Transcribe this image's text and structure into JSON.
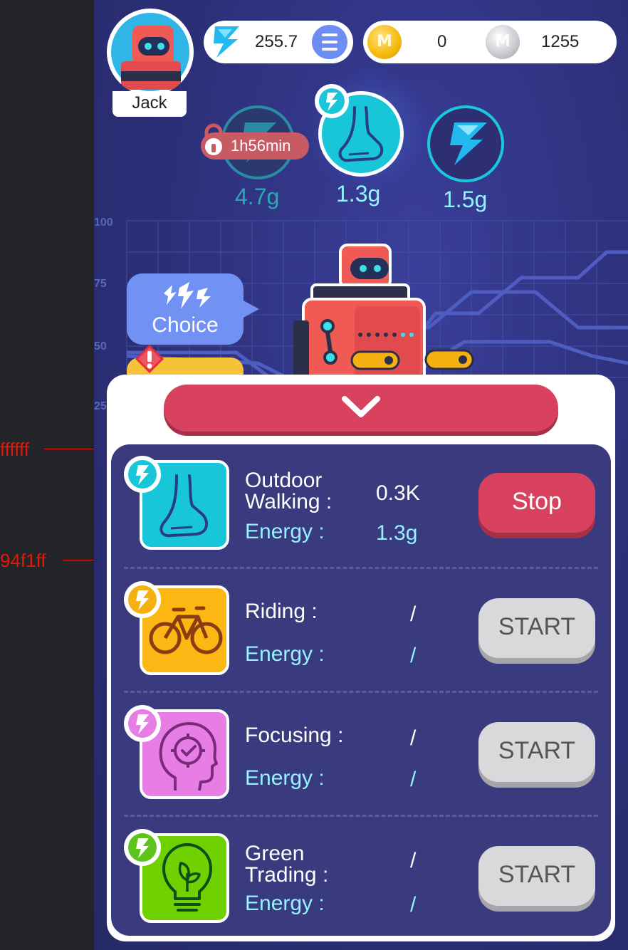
{
  "annotations": {
    "top_color": "ffffff",
    "bottom_color": "94f1ff"
  },
  "user": {
    "name": "Jack"
  },
  "balances": {
    "energy": "255.7",
    "gold": "0",
    "silver": "1255"
  },
  "energy_nodes": [
    {
      "value": "4.7g",
      "state": "locked",
      "lock_text": "1h56min",
      "icon": "lightning-icon",
      "color": "#2aa9b0"
    },
    {
      "value": "1.3g",
      "state": "active",
      "icon": "foot-icon",
      "color": "#94f1ff"
    },
    {
      "value": "1.5g",
      "state": "ready",
      "icon": "lightning-icon",
      "color": "#94f1ff"
    }
  ],
  "chart_data": {
    "type": "line",
    "yticks": [
      "100",
      "75",
      "50",
      "25"
    ]
  },
  "choice_bubble": {
    "label": "Choice"
  },
  "activities": [
    {
      "name_lines": [
        "Outdoor",
        "Walking :"
      ],
      "value": "0.3K",
      "energy_label": "Energy :",
      "energy_value": "1.3g",
      "button": "Stop",
      "button_kind": "stop",
      "icon": "foot-icon",
      "tile_color": "#19c6d9",
      "badge_color": "#19c6d9"
    },
    {
      "name_lines": [
        "Riding :"
      ],
      "value": "/",
      "energy_label": "Energy :",
      "energy_value": "/",
      "button": "START",
      "button_kind": "start",
      "icon": "bicycle-icon",
      "tile_color": "#fdb714",
      "badge_color": "#f5b011"
    },
    {
      "name_lines": [
        "Focusing :"
      ],
      "value": "/",
      "energy_label": "Energy :",
      "energy_value": "/",
      "button": "START",
      "button_kind": "start",
      "icon": "head-focus-icon",
      "tile_color": "#e77ee6",
      "badge_color": "#e77ee6"
    },
    {
      "name_lines": [
        "Green",
        "Trading :"
      ],
      "value": "/",
      "energy_label": "Energy :",
      "energy_value": "/",
      "button": "START",
      "button_kind": "start",
      "icon": "lightbulb-icon",
      "tile_color": "#6fd100",
      "badge_color": "#5cc41a"
    }
  ]
}
